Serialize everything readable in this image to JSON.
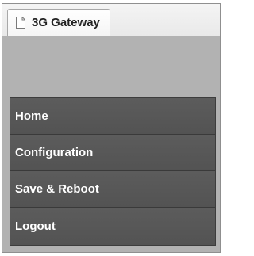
{
  "tab": {
    "title": "3G Gateway",
    "icon": "page-icon"
  },
  "menu": {
    "items": [
      {
        "label": "Home"
      },
      {
        "label": "Configuration"
      },
      {
        "label": "Save & Reboot"
      },
      {
        "label": "Logout"
      }
    ]
  },
  "colors": {
    "background": "#b2b2b2",
    "menu_item": "#575757",
    "menu_text": "#ffffff"
  }
}
